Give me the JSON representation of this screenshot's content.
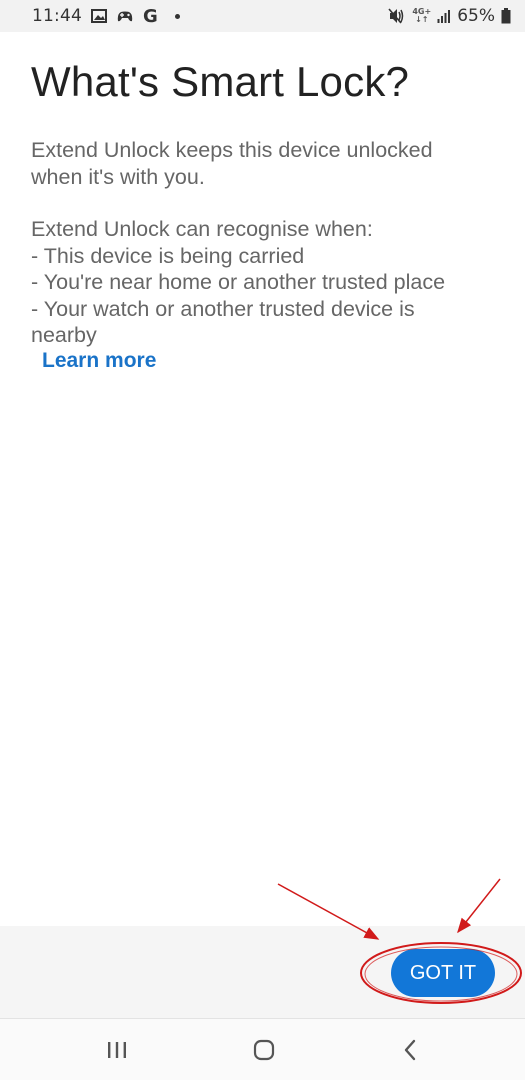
{
  "status_bar": {
    "time": "11:44",
    "left_icons": [
      "gallery-icon",
      "game-controller-icon",
      "google-icon",
      "notification-dot-icon"
    ],
    "google_letter": "G",
    "network_label_top": "4G+",
    "network_label_bottom": "↓↑",
    "right_icons": [
      "mute-icon",
      "network-4g-icon",
      "signal-icon",
      "battery-icon"
    ],
    "battery_percent": "65%"
  },
  "dialog": {
    "title": "What's Smart Lock?",
    "paragraph1": [
      "Extend Unlock keeps this device unlocked",
      "when it's with you."
    ],
    "paragraph2": [
      "Extend Unlock can recognise when:",
      " - This device is being carried",
      " - You're near home or another trusted place",
      " - Your watch or another trusted device is",
      "nearby"
    ],
    "learn_more_label": "Learn more"
  },
  "actions": {
    "got_it_label": "GOT IT"
  },
  "annotation": {
    "color": "#d11a1a",
    "shapes": [
      "arrow",
      "arrow",
      "ellipse"
    ]
  },
  "nav_bar": {
    "buttons": [
      "recents-icon",
      "home-icon",
      "back-icon"
    ]
  },
  "colors": {
    "accent": "#1277d8",
    "link": "#1a73c8",
    "body_text": "#666666",
    "title_text": "#222222"
  }
}
